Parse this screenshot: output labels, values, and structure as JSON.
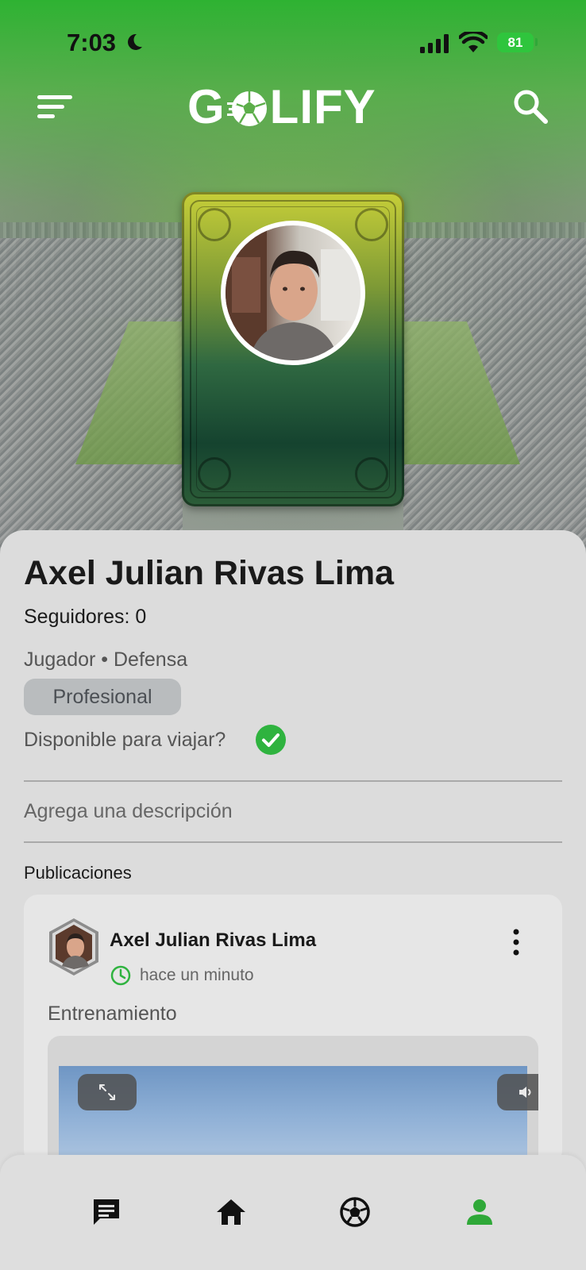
{
  "status_bar": {
    "time": "7:03",
    "battery": "81"
  },
  "header": {
    "logo_left": "G",
    "logo_right": "LIFY",
    "menu_icon": "menu-icon",
    "search_icon": "search-icon"
  },
  "profile": {
    "name": "Axel Julian Rivas Lima",
    "followers": "Seguidores: 0",
    "role": "Jugador • Defensa",
    "level": "Profesional",
    "travel": "Disponible para viajar?",
    "description_placeholder": "Agrega una descripción"
  },
  "posts": {
    "section_title": "Publicaciones",
    "items": [
      {
        "author": "Axel Julian Rivas Lima",
        "time": "hace un minuto",
        "text": "Entrenamiento"
      }
    ]
  },
  "bottom_nav": {
    "items": [
      {
        "icon": "chat-icon",
        "active": false
      },
      {
        "icon": "home-icon",
        "active": false
      },
      {
        "icon": "soccer-ball-icon",
        "active": false
      },
      {
        "icon": "profile-icon",
        "active": true
      }
    ]
  },
  "colors": {
    "brand_green": "#2eb232",
    "active_nav": "#2fa838",
    "check_green": "#2fb33f"
  }
}
